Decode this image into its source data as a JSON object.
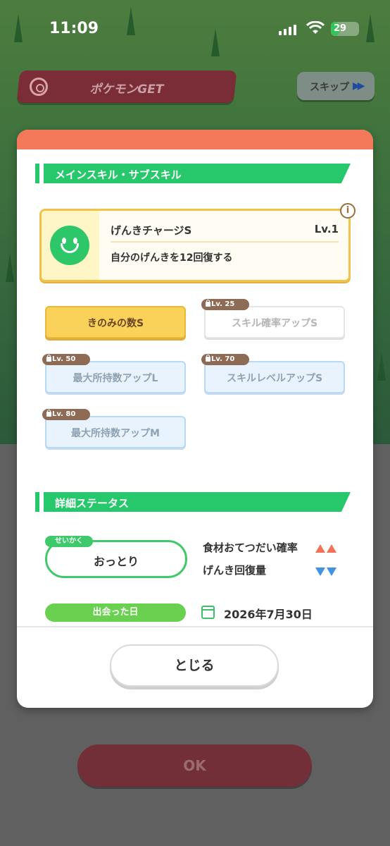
{
  "status_bar": {
    "time": "11:09",
    "battery": "29",
    "battery_level": 0.29
  },
  "header": {
    "title": "ポケモンGET",
    "skip_label": "スキップ"
  },
  "modal": {
    "main_section_title": "メインスキル・サブスキル",
    "main_skill": {
      "name": "げんきチャージS",
      "level": "Lv.1",
      "description": "自分のげんきを12回復する",
      "icon": "smile-face-icon"
    },
    "sub_skills": [
      {
        "label": "きのみの数S",
        "lock": "",
        "state": "unlocked"
      },
      {
        "label": "スキル確率アップS",
        "lock": "Lv. 25",
        "state": "locked"
      },
      {
        "label": "最大所持数アップL",
        "lock": "Lv. 50",
        "state": "locked"
      },
      {
        "label": "スキルレベルアップS",
        "lock": "Lv. 70",
        "state": "locked"
      },
      {
        "label": "最大所持数アップM",
        "lock": "Lv. 80",
        "state": "locked"
      }
    ],
    "detail_section_title": "詳細ステータス",
    "nature": {
      "tag": "せいかく",
      "value": "おっとり",
      "up_effect": "食材おてつだい確率",
      "down_effect": "げんき回復量"
    },
    "met": {
      "label": "出会った日",
      "date": "2026年7月30日"
    },
    "close_label": "とじる"
  },
  "ok_label": "OK",
  "colors": {
    "accent_green": "#27c76b",
    "modal_top": "#f4795b",
    "dark_red": "#722f38",
    "up": "#f2715a",
    "down": "#3f93e6"
  }
}
